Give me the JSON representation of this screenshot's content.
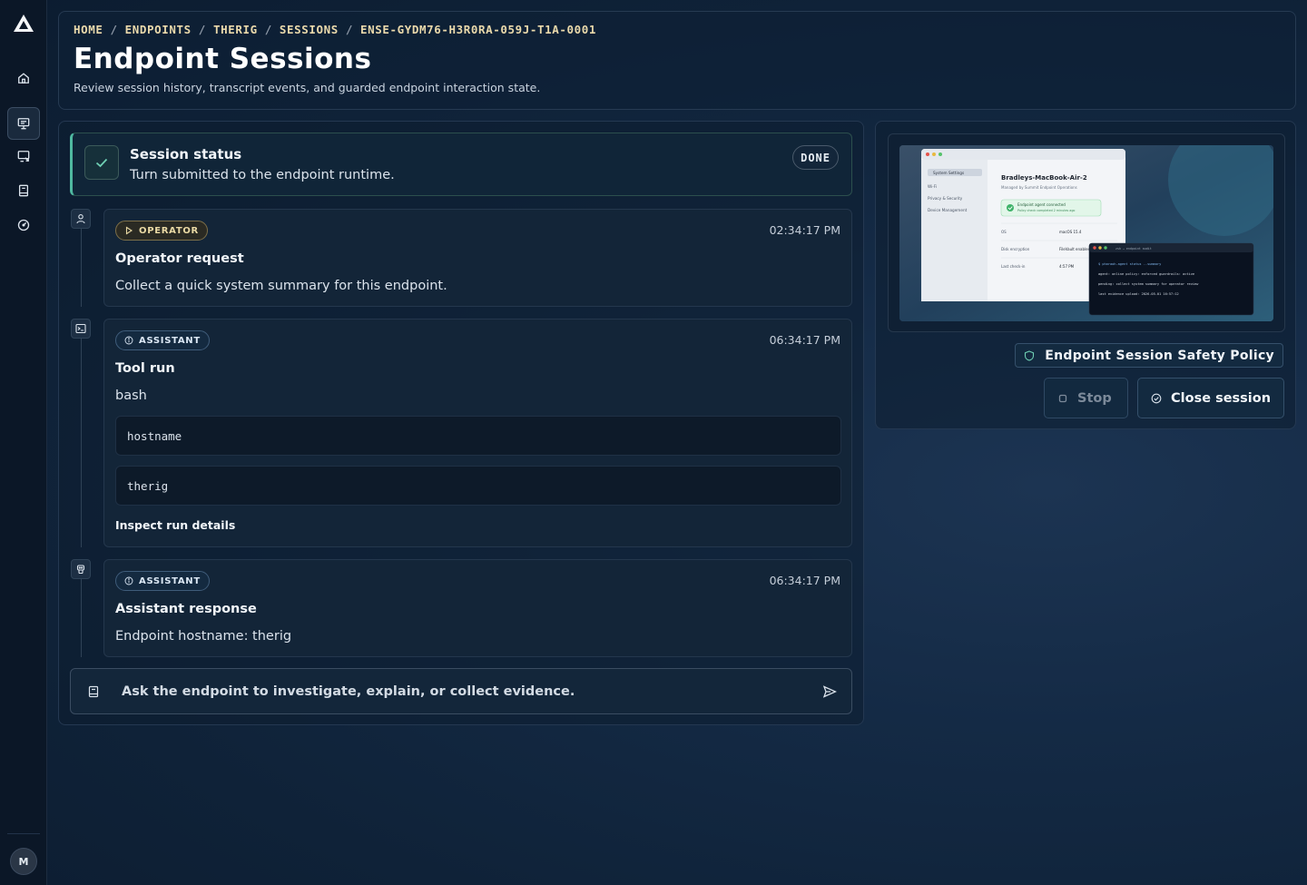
{
  "sidebar": {
    "items": [
      {
        "icon": "home-icon"
      },
      {
        "icon": "monitor-icon",
        "active": true
      },
      {
        "icon": "remote-screen-icon"
      },
      {
        "icon": "book-icon"
      },
      {
        "icon": "gauge-icon"
      }
    ],
    "avatar_initial": "M"
  },
  "header": {
    "breadcrumb": [
      "HOME",
      "ENDPOINTS",
      "THERIG",
      "SESSIONS",
      "ENSE-GYDM76-H3R0RA-059J-T1A-0001"
    ],
    "breadcrumb_sep": "/",
    "title": "Endpoint Sessions",
    "subtitle": "Review session history, transcript events, and guarded endpoint interaction state."
  },
  "status": {
    "title": "Session status",
    "text": "Turn submitted to the endpoint runtime.",
    "badge": "DONE",
    "accent": "#4fb8a0"
  },
  "messages": [
    {
      "role": "OPERATOR",
      "time": "02:34:17 PM",
      "title": "Operator request",
      "body": "Collect a quick system summary for this endpoint."
    },
    {
      "role": "ASSISTANT",
      "time": "06:34:17 PM",
      "title": "Tool run",
      "body": "bash",
      "command": "hostname",
      "output": "therig",
      "link": "Inspect run details"
    },
    {
      "role": "ASSISTANT",
      "time": "06:34:17 PM",
      "title": "Assistant response",
      "body": "Endpoint hostname: therig"
    }
  ],
  "composer": {
    "placeholder": "Ask the endpoint to investigate, explain, or collect evidence."
  },
  "right_panel": {
    "policy_label": "Endpoint Session Safety Policy",
    "stop_label": "Stop",
    "close_label": "Close session",
    "preview": {
      "settings_title": "System Settings",
      "menu": [
        "Wi-Fi",
        "Privacy & Security",
        "Device Management"
      ],
      "device_name": "Bradleys-MacBook-Air-2",
      "managed_by": "Managed by Summit Endpoint Operations",
      "agent_status": "Endpoint agent connected",
      "agent_sub": "Policy check completed 2 minutes ago",
      "rows": [
        {
          "k": "OS",
          "v": "macOS 15.4"
        },
        {
          "k": "Disk encryption",
          "v": "FileVault enabled"
        },
        {
          "k": "Last check-in",
          "v": "4:57 PM"
        }
      ],
      "terminal_title": "zsh — endpoint audit",
      "terminal_lines": [
        "$ pharaoh-agent status --summary",
        "agent: online policy: enforced guardrails: active",
        "pending: collect system summary for operator review",
        "last evidence upload: 2026-05-01 16:57:12"
      ]
    }
  }
}
